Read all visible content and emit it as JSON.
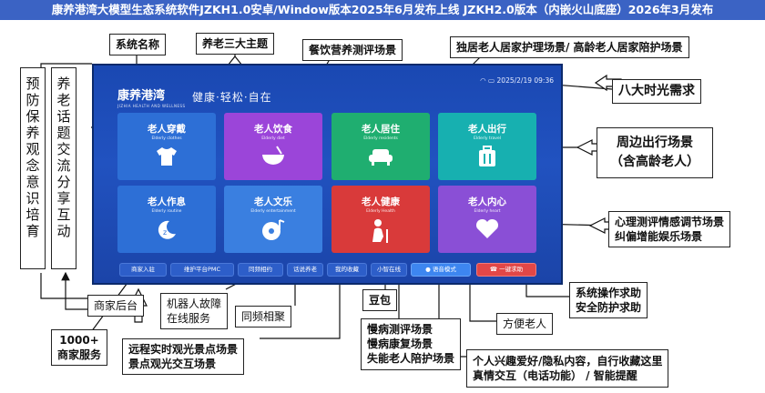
{
  "banner": "康养港湾大模型生态系统软件JZKH1.0安卓/Window版本2025年6月发布上线 JZKH2.0版本（内嵌火山底座）2026年3月发布",
  "screen": {
    "logo": "康养港湾",
    "logo_sub": "JIZHIA HEALTH AND WELLNESS",
    "slogan": "健康·轻松·自在",
    "status": "2025/2/19  09:36",
    "tiles": [
      {
        "title": "老人穿戴",
        "sub": "Elderly clothes",
        "color": "#2d6fd6",
        "icon": "shirt-icon"
      },
      {
        "title": "老人饮食",
        "sub": "Elderly diet",
        "color": "#9b45d9",
        "icon": "bowl-icon"
      },
      {
        "title": "老人居住",
        "sub": "Elderly residents",
        "color": "#1fae70",
        "icon": "sofa-icon"
      },
      {
        "title": "老人出行",
        "sub": "Elderly travel",
        "color": "#17b0b0",
        "icon": "luggage-icon"
      },
      {
        "title": "老人作息",
        "sub": "Elderly routine",
        "color": "#2d6fd6",
        "icon": "moon-clock-icon"
      },
      {
        "title": "老人文乐",
        "sub": "Elderly entertainment",
        "color": "#3a7fe0",
        "icon": "music-disc-icon"
      },
      {
        "title": "老人健康",
        "sub": "Elderly Health",
        "color": "#d93a3a",
        "icon": "elder-person-icon"
      },
      {
        "title": "老人内心",
        "sub": "Elderly heart",
        "color": "#8a4fd6",
        "icon": "heart-icon"
      }
    ],
    "bottom": {
      "merchant": "商家入驻",
      "robot": "维护平台PMC",
      "dating": "同频相约",
      "chat": "话说养老",
      "favorites": "我的收藏",
      "xiaobao": "小智在线",
      "voice": "语音模式",
      "sos": "一键求助"
    }
  },
  "callouts": {
    "system_name": "系统名称",
    "three_themes": "养老三大主题",
    "diet": "餐饮营养测评场景",
    "residence": "独居老人居家护理场景/  高龄老人居家陪护场景",
    "eight_hours": "八大时光需求",
    "travel_1": "周边出行场景",
    "travel_2": "（含高龄老人）",
    "psych_1": "心理测评情感调节场景",
    "psych_2": "纠偏增能娱乐场景",
    "sos_1": "系统操作求助",
    "sos_2": "安全防护求助",
    "convenience": "方便老人",
    "doubao": "豆包",
    "health_1": "慢病测评场景",
    "health_2": "慢病康复场景",
    "health_3": "失能老人陪护场景",
    "personal_1": "个人兴趣爱好/隐私内容，自行收藏这里",
    "personal_2": "真情交互（电话功能） / 智能提醒",
    "merchant_back": "商家后台",
    "robot_1": "机器人故障",
    "robot_2": "在线服务",
    "same_freq": "同频相聚",
    "merchants_1": "1000+",
    "merchants_2": "商家服务",
    "remote_1": "远程实时观光景点场景",
    "remote_2": "景点观光交互场景",
    "vert_left": "预防保养观念意识培育",
    "vert_right": "养老话题交流分享互动"
  }
}
